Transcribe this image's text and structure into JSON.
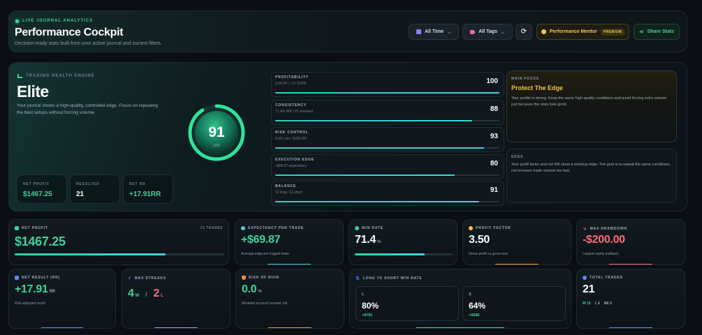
{
  "header": {
    "live_label": "LIVE JOURNAL ANALYTICS",
    "title": "Performance Cockpit",
    "subtitle": "Decision-ready stats built from your active journal and current filters.",
    "time_filter": "All Time",
    "tags_filter": "All Tags",
    "mentor_label": "Performance Mentor",
    "premium_badge": "PREMIUM",
    "share_label": "Share Stats"
  },
  "health": {
    "engine_label": "TRADING HEALTH ENGINE",
    "grade": "Elite",
    "description": "Your journal shows a high-quality, controlled edge. Focus on repeating the best setups without forcing volume.",
    "score": "91",
    "score_max": "/100",
    "score_value": 91,
    "mini_stats": [
      {
        "label": "NET PROFIT",
        "value": "$1467.25"
      },
      {
        "label": "RESOLVED",
        "value": "21"
      },
      {
        "label": "NET RR",
        "value": "+17.91RR"
      }
    ],
    "metrics": [
      {
        "name": "PROFITABILITY",
        "detail": "3.50 PF / +17.91RR",
        "value": "100",
        "score": 100
      },
      {
        "name": "CONSISTENCY",
        "detail": "71.4% WR / 21 resolved",
        "value": "88",
        "score": 88
      },
      {
        "name": "RISK CONTROL",
        "detail": "0.0% ruin / $200 DD",
        "value": "93",
        "score": 93
      },
      {
        "name": "EXECUTION EDGE",
        "detail": "+$69.87 expectancy",
        "value": "80",
        "score": 80
      },
      {
        "name": "BALANCE",
        "detail": "10 long / 11 short",
        "value": "91",
        "score": 91
      }
    ],
    "main_focus": {
      "label": "MAIN FOCUS",
      "title": "Protect The Edge",
      "text": "Your profile is strong. Keep the same high-quality conditions and avoid forcing extra volume just because the stats look good."
    },
    "edge": {
      "label": "EDGE",
      "text": "Your profit factor and net RR show a working edge. The goal is to repeat the same conditions, not increase trade volume too fast."
    }
  },
  "cards": {
    "net_profit": {
      "label": "NET PROFIT",
      "right": "21 TRADES",
      "value": "$1467.25",
      "progress": 0.72
    },
    "expectancy": {
      "label": "EXPECTANCY PER TRADE",
      "value": "+$69.87",
      "sub": "Average edge per logged trade"
    },
    "win_rate": {
      "label": "WIN RATE",
      "value": "71.4",
      "suffix": "%",
      "progress": 0.714
    },
    "profit_factor": {
      "label": "PROFIT FACTOR",
      "value": "3.50",
      "sub": "Gross profit vs gross loss"
    },
    "max_drawdown": {
      "label": "MAX DRAWDOWN",
      "value": "-$200.00",
      "sub": "Largest equity pullback"
    },
    "net_result": {
      "label": "NET RESULT (RR)",
      "value": "+17.91",
      "suffix": "RR",
      "sub": "Risk-adjusted result"
    },
    "max_streaks": {
      "label": "MAX STREAKS",
      "win": "4",
      "win_suffix": "W",
      "sep": "/",
      "loss": "2",
      "loss_suffix": "L"
    },
    "risk_of_ruin": {
      "label": "RISK OF RUIN",
      "value": "0.0",
      "suffix": "%",
      "sub": "Modeled account survival risk"
    },
    "long_short": {
      "label": "LONG VS SHORT WIN RATE",
      "long": {
        "label": "L",
        "value": "80%",
        "sub": "+$781"
      },
      "short": {
        "label": "S",
        "value": "64%",
        "sub": "+$686"
      }
    },
    "total_trades": {
      "label": "TOTAL TRADES",
      "value": "21",
      "w": "W 15",
      "l": "L 6",
      "be": "BE 0"
    }
  },
  "colors": {
    "accent_green": "#3fd39a",
    "accent_teal": "#2ed3c0",
    "warning_gold": "#f5c542",
    "loss_red": "#ff6b7d"
  }
}
